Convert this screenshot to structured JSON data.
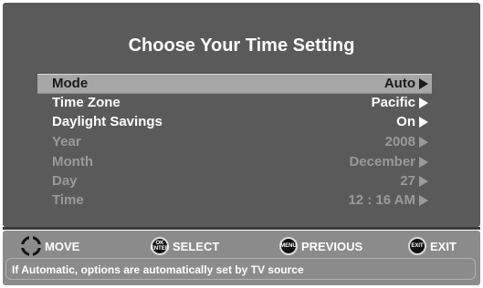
{
  "menu": {
    "title": "Choose Your Time Setting",
    "rows": [
      {
        "label": "Mode",
        "value": "Auto",
        "state": "selected"
      },
      {
        "label": "Time Zone",
        "value": "Pacific",
        "state": "enabled"
      },
      {
        "label": "Daylight Savings",
        "value": "On",
        "state": "enabled"
      },
      {
        "label": "Year",
        "value": "2008",
        "state": "disabled"
      },
      {
        "label": "Month",
        "value": "December",
        "state": "disabled"
      },
      {
        "label": "Day",
        "value": "27",
        "state": "disabled"
      },
      {
        "label": "Time",
        "value": "12 : 16 AM",
        "state": "disabled"
      }
    ]
  },
  "nav": {
    "move": {
      "label": "MOVE",
      "icon": "dpad-icon"
    },
    "select": {
      "label": "SELECT",
      "icon": "ok-enter-icon",
      "icon_text_top": "OK",
      "icon_text_bottom": "ENTER"
    },
    "previous": {
      "label": "PREVIOUS",
      "icon": "menu-icon",
      "icon_text": "MENU"
    },
    "exit": {
      "label": "EXIT",
      "icon": "exit-icon",
      "icon_text": "EXIT"
    }
  },
  "info": {
    "text": "If Automatic, options are automatically set by TV source"
  },
  "colors": {
    "screen_bg": "#5a5a5a",
    "highlight_bg": "#a6a6a6",
    "nav_bg": "#8b8b8b",
    "enabled_text": "#ffffff",
    "disabled_text": "#9a9a9a"
  }
}
